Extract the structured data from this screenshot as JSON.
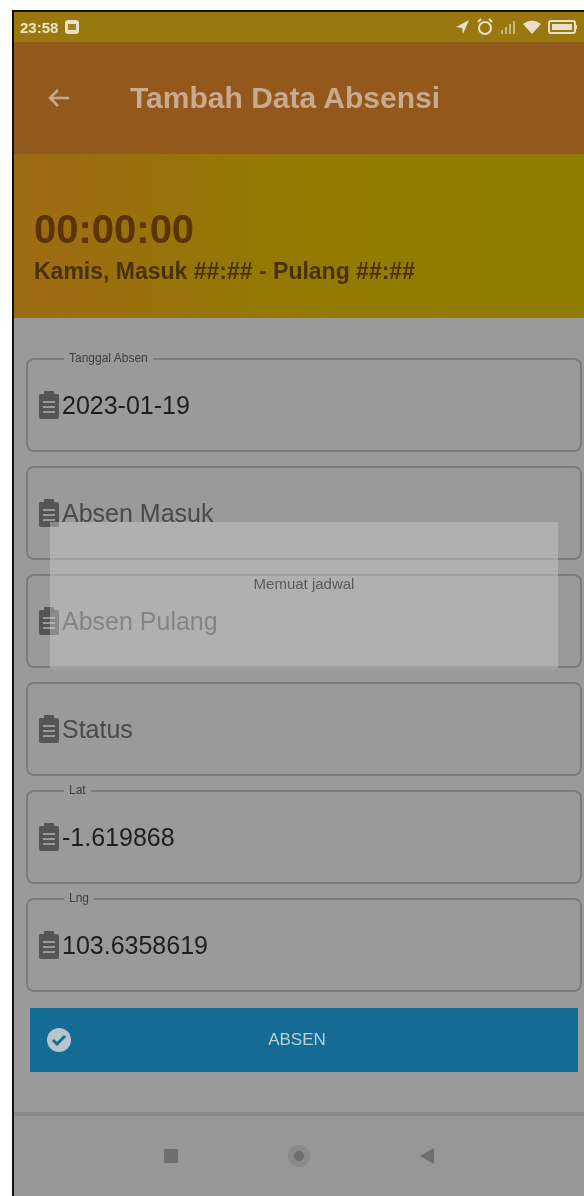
{
  "status_bar": {
    "time": "23:58"
  },
  "app_bar": {
    "title": "Tambah Data Absensi"
  },
  "header": {
    "clock": "00:00:00",
    "schedule": "Kamis, Masuk ##:## - Pulang ##:##"
  },
  "fields": [
    {
      "label": "Tanggal Absen",
      "value": "2023-01-19"
    },
    {
      "placeholder": "Absen Masuk"
    },
    {
      "placeholder": "Absen Pulang"
    },
    {
      "placeholder": "Status"
    },
    {
      "label": "Lat",
      "value": "-1.619868"
    },
    {
      "label": "Lng",
      "value": "103.6358619"
    }
  ],
  "submit_button": {
    "label": "ABSEN"
  },
  "loading_dialog": {
    "message": "Memuat jadwal"
  }
}
